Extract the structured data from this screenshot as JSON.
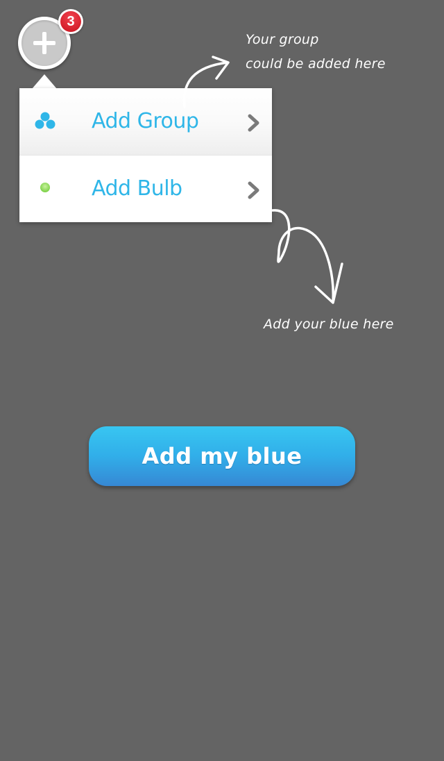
{
  "fab": {
    "icon": "plus-icon",
    "badge_count": "3"
  },
  "menu": {
    "items": [
      {
        "label": "Add Group",
        "icon": "group-dots-icon",
        "icon_color": "#2fb6e8",
        "chevron": "chevron-right-icon"
      },
      {
        "label": "Add Bulb",
        "icon": "bulb-dot-icon",
        "icon_color": "#9be06a",
        "chevron": "chevron-right-icon"
      }
    ]
  },
  "hints": {
    "group_line1": "Your group",
    "group_line2": "could be added here",
    "bulb": "Add your blue here"
  },
  "cta": {
    "label": "Add my blue"
  },
  "colors": {
    "background": "#646464",
    "accent": "#2fb6e8",
    "badge": "#d6202c",
    "cta_top": "#38c6f1",
    "cta_bottom": "#3688d4"
  }
}
